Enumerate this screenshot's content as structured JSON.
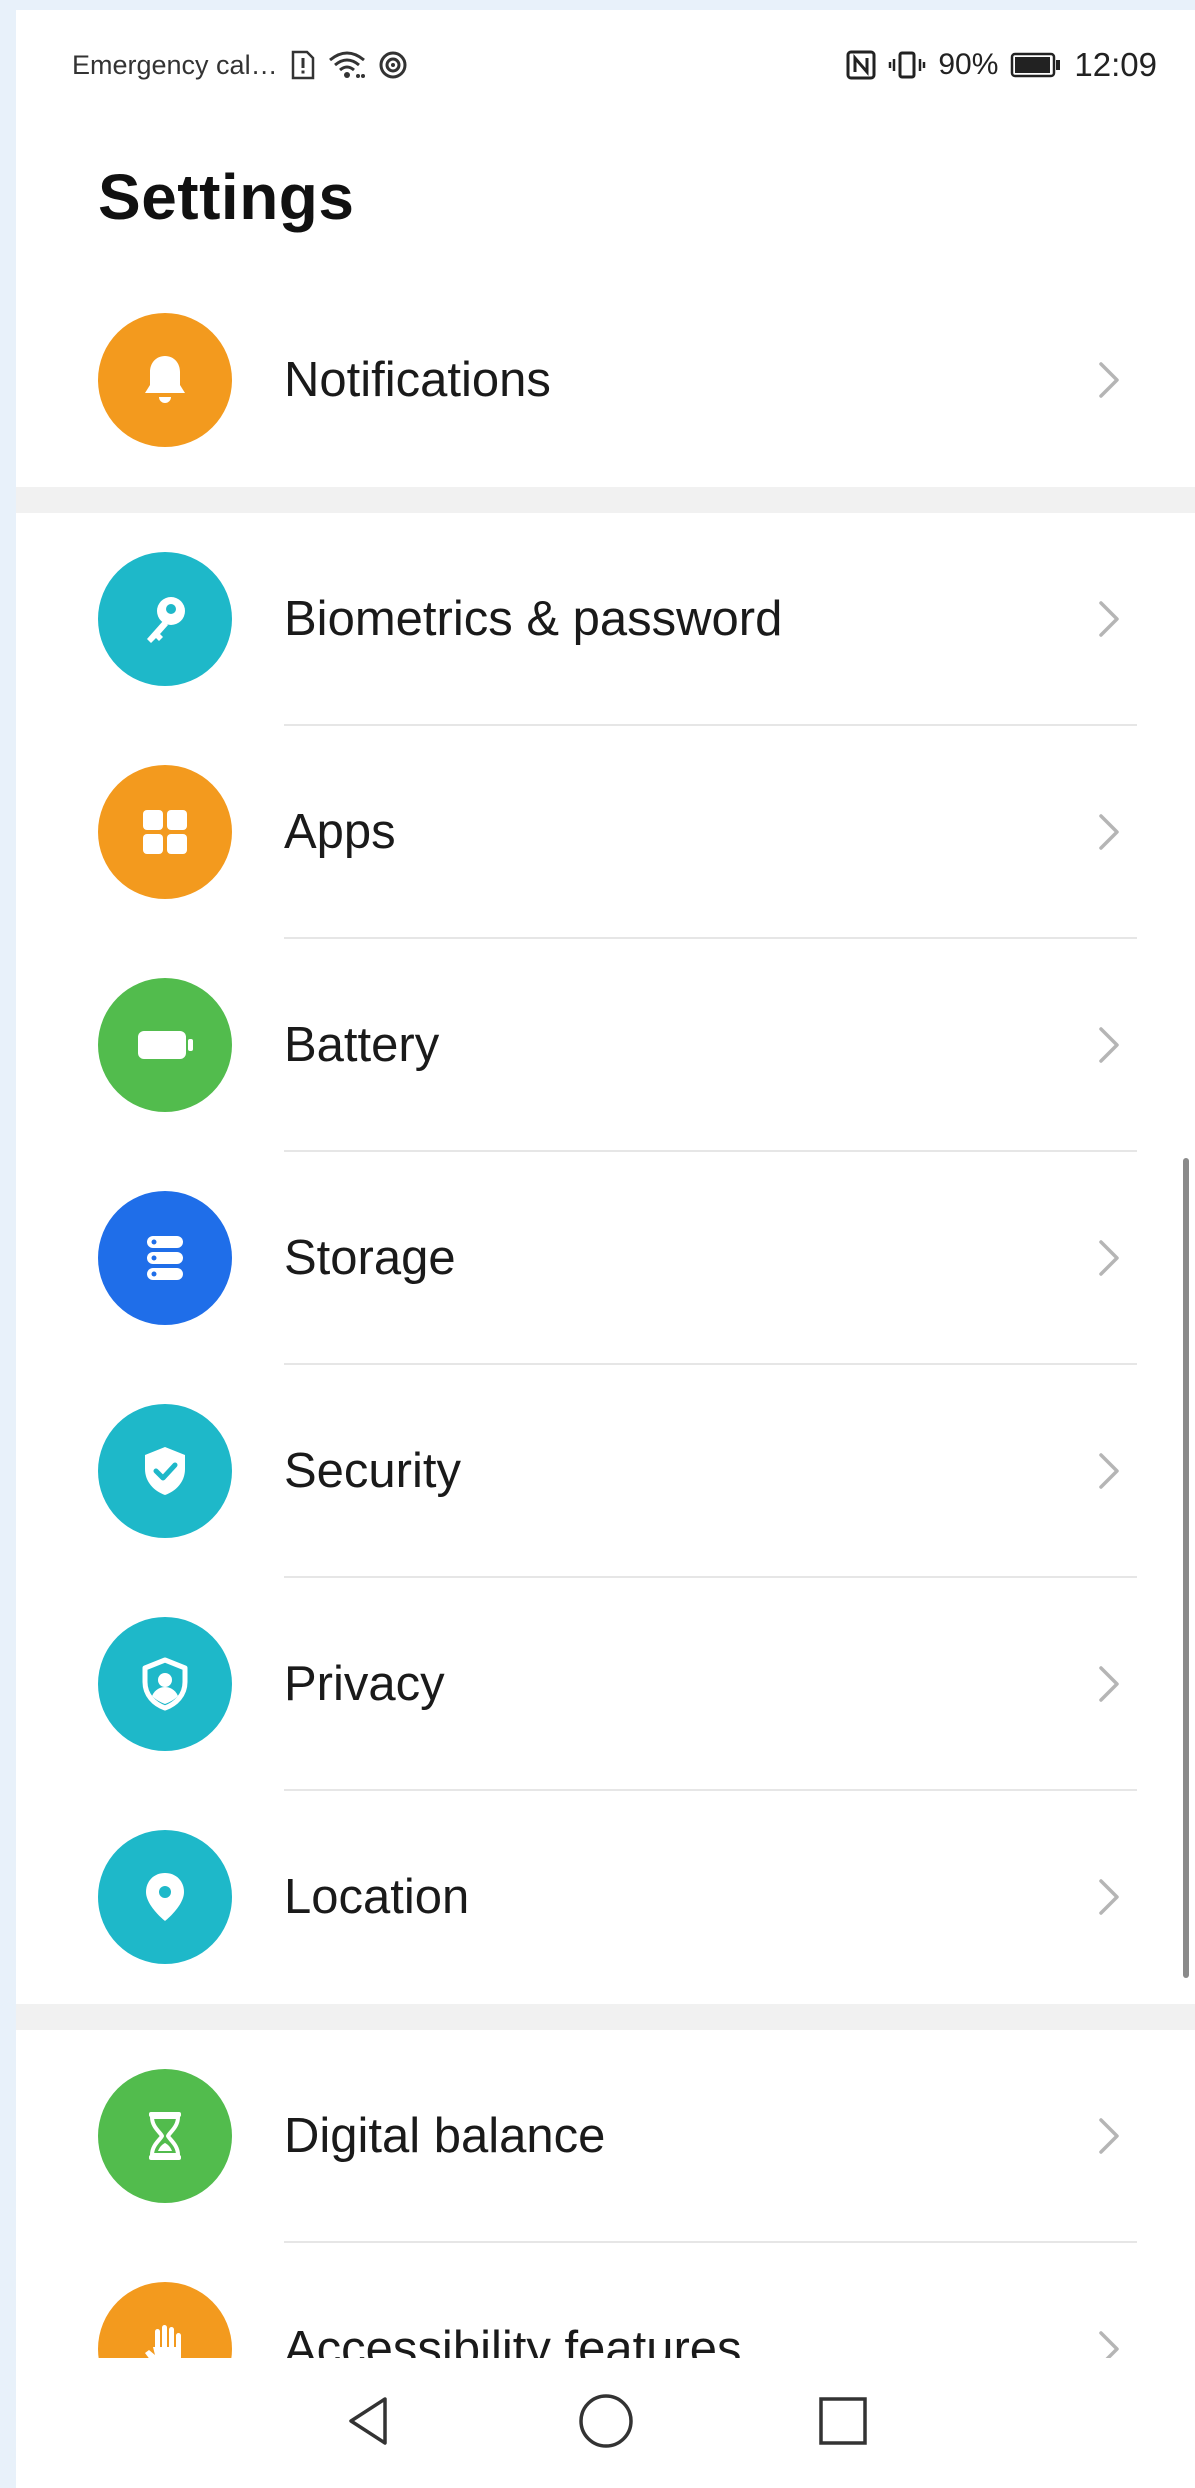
{
  "status_bar": {
    "carrier_text": "Emergency cal…",
    "battery_percent": "90%",
    "time": "12:09",
    "icons": [
      "sim-alert-icon",
      "wifi-icon",
      "hotspot-icon",
      "nfc-icon",
      "vibrate-icon",
      "battery-icon"
    ]
  },
  "page": {
    "title": "Settings"
  },
  "sections": [
    {
      "items": [
        {
          "label": "Notifications",
          "icon": "bell-icon",
          "color": "#F39A1E"
        }
      ]
    },
    {
      "items": [
        {
          "label": "Biometrics & password",
          "icon": "key-icon",
          "color": "#1EB8C9"
        },
        {
          "label": "Apps",
          "icon": "apps-grid-icon",
          "color": "#F39A1E"
        },
        {
          "label": "Battery",
          "icon": "battery-icon",
          "color": "#52BC4D"
        },
        {
          "label": "Storage",
          "icon": "storage-icon",
          "color": "#1F6EE9"
        },
        {
          "label": "Security",
          "icon": "shield-check-icon",
          "color": "#1EB8C9"
        },
        {
          "label": "Privacy",
          "icon": "privacy-icon",
          "color": "#1EB8C9"
        },
        {
          "label": "Location",
          "icon": "location-pin-icon",
          "color": "#1EB8C9"
        }
      ]
    },
    {
      "items": [
        {
          "label": "Digital balance",
          "icon": "hourglass-icon",
          "color": "#52BC4D"
        },
        {
          "label": "Accessibility features",
          "icon": "hand-icon",
          "color": "#F39A1E"
        }
      ]
    }
  ],
  "nav_bar": {
    "buttons": [
      "back-icon",
      "home-icon",
      "recents-icon"
    ]
  },
  "colors": {
    "chevron": "#b5b5b5",
    "separator": "#f1f1f1",
    "divider": "#e6e6e6"
  }
}
